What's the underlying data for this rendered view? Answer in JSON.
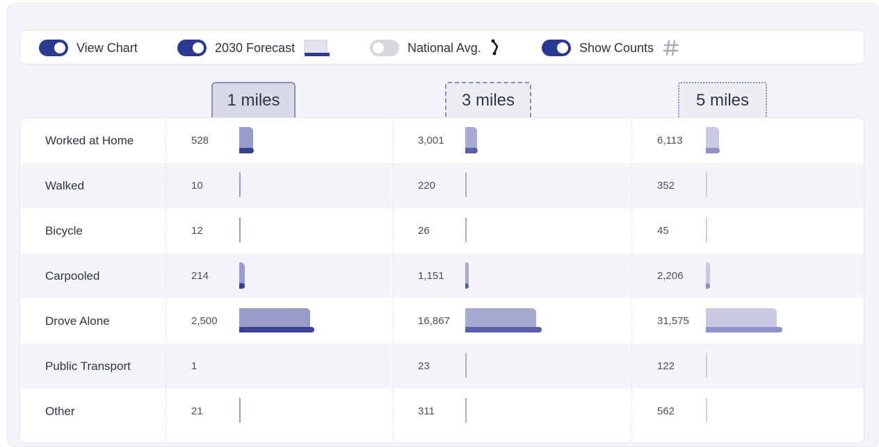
{
  "toolbar": {
    "toggles": [
      {
        "label": "View Chart",
        "on": true
      },
      {
        "label": "2030 Forecast",
        "on": true,
        "icon": "forecast-bar-icon"
      },
      {
        "label": "National Avg.",
        "on": false,
        "icon": "national-avg-line-icon"
      },
      {
        "label": "Show Counts",
        "on": true,
        "icon": "hash-icon"
      }
    ]
  },
  "tabs": [
    {
      "label": "1 miles",
      "style": "active"
    },
    {
      "label": "3 miles",
      "style": "dashed"
    },
    {
      "label": "5 miles",
      "style": "dotted"
    }
  ],
  "colors": {
    "accent": "#2b3990",
    "bar_1mi": "#9a9bc9",
    "bar_3mi": "#a9aad4",
    "bar_5mi": "#c9c9e2",
    "forecast_1mi": "#3b4196",
    "forecast_3mi": "#5b5fae",
    "forecast_5mi": "#8f91c8"
  },
  "rows": [
    {
      "label": "Worked at Home",
      "values": [
        "528",
        "3,001",
        "6,113"
      ],
      "share": [
        0.2,
        0.17,
        0.19
      ],
      "forecast": [
        0.21,
        0.18,
        0.2
      ]
    },
    {
      "label": "Walked",
      "values": [
        "10",
        "220",
        "352"
      ],
      "share": [
        0.004,
        0.012,
        0.011
      ],
      "forecast": [
        0,
        0,
        0
      ]
    },
    {
      "label": "Bicycle",
      "values": [
        "12",
        "26",
        "45"
      ],
      "share": [
        0.005,
        0.002,
        0.001
      ],
      "forecast": [
        0,
        0,
        0
      ]
    },
    {
      "label": "Carpooled",
      "values": [
        "214",
        "1,151",
        "2,206"
      ],
      "share": [
        0.08,
        0.05,
        0.06
      ],
      "forecast": [
        0.08,
        0.05,
        0.06
      ]
    },
    {
      "label": "Drove Alone",
      "values": [
        "2,500",
        "16,867",
        "31,575"
      ],
      "share": [
        1.0,
        1.0,
        1.0
      ],
      "forecast": [
        1.06,
        1.08,
        1.08
      ]
    },
    {
      "label": "Public Transport",
      "values": [
        "1",
        "23",
        "122"
      ],
      "share": [
        0.0,
        0.001,
        0.004
      ],
      "forecast": [
        0,
        0,
        0
      ]
    },
    {
      "label": "Other",
      "values": [
        "21",
        "311",
        "562"
      ],
      "share": [
        0.008,
        0.015,
        0.018
      ],
      "forecast": [
        0,
        0,
        0
      ]
    }
  ]
}
